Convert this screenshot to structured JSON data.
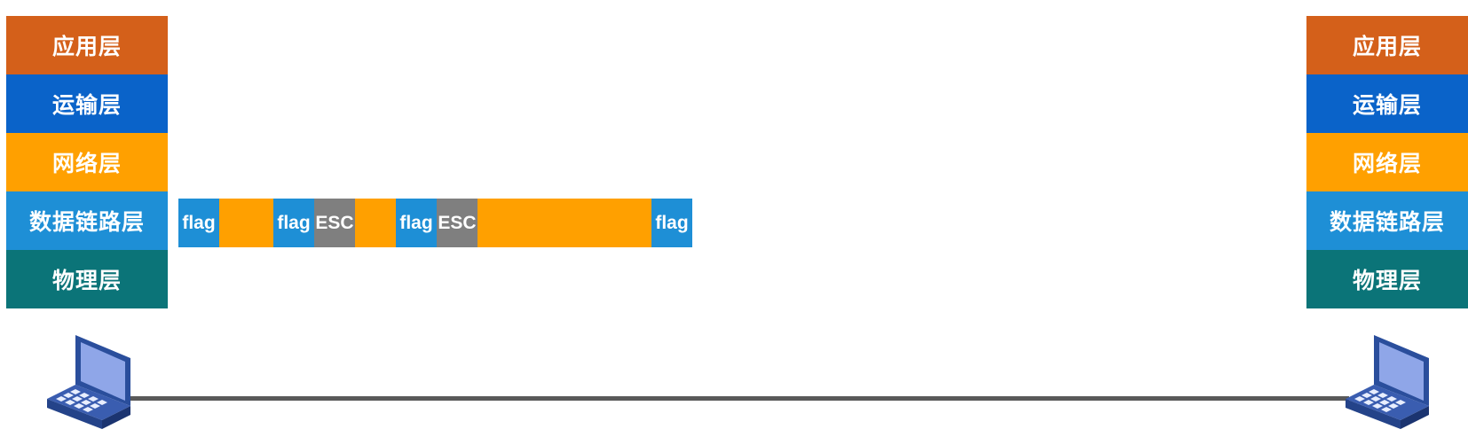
{
  "layers_left": [
    {
      "label": "应用层",
      "color": "#D4601A"
    },
    {
      "label": "运输层",
      "color": "#0A63C9"
    },
    {
      "label": "网络层",
      "color": "#FFA000"
    },
    {
      "label": "数据链路层",
      "color": "#1E8FD6"
    },
    {
      "label": "物理层",
      "color": "#0B7478"
    }
  ],
  "layers_right": [
    {
      "label": "应用层",
      "color": "#D4601A"
    },
    {
      "label": "运输层",
      "color": "#0A63C9"
    },
    {
      "label": "网络层",
      "color": "#FFA000"
    },
    {
      "label": "数据链路层",
      "color": "#1E8FD6"
    },
    {
      "label": "物理层",
      "color": "#0B7478"
    }
  ],
  "frame": [
    {
      "type": "flag",
      "text": "flag",
      "color": "#1E8FD6"
    },
    {
      "type": "data",
      "text": "",
      "color": "#FFA000"
    },
    {
      "type": "flag",
      "text": "flag",
      "color": "#1E8FD6"
    },
    {
      "type": "esc",
      "text": "ESC",
      "color": "#7F7F7F"
    },
    {
      "type": "data",
      "text": "",
      "color": "#FFA000"
    },
    {
      "type": "flag",
      "text": "flag",
      "color": "#1E8FD6"
    },
    {
      "type": "esc",
      "text": "ESC",
      "color": "#7F7F7F"
    },
    {
      "type": "data",
      "text": "",
      "color": "#FFA000"
    },
    {
      "type": "flag",
      "text": "flag",
      "color": "#1E8FD6"
    }
  ],
  "icons": {
    "left_host": "laptop-icon",
    "right_host": "laptop-icon"
  }
}
